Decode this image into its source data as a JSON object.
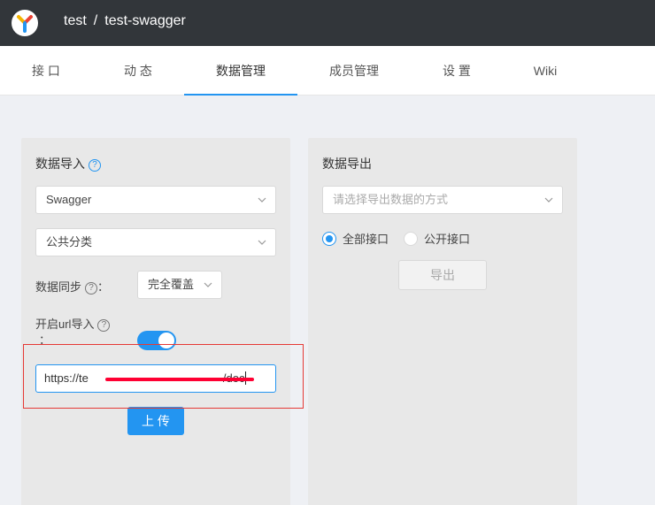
{
  "header": {
    "group": "test",
    "separator": "/",
    "project": "test-swagger"
  },
  "tabs": [
    {
      "label": "接 口"
    },
    {
      "label": "动 态"
    },
    {
      "label": "数据管理",
      "active": true
    },
    {
      "label": "成员管理"
    },
    {
      "label": "设 置"
    },
    {
      "label": "Wiki"
    }
  ],
  "import_panel": {
    "title": "数据导入",
    "help_glyph": "?",
    "format_select": "Swagger",
    "category_select": "公共分类",
    "sync_label": "数据同步",
    "sync_colon": "：",
    "sync_select": "完全覆盖",
    "url_label": "开启url导入",
    "url_colon": "：",
    "url_toggle_on": true,
    "url_value_start": "https://te",
    "url_value_end": "/doc",
    "upload_button": "上 传"
  },
  "export_panel": {
    "title": "数据导出",
    "method_placeholder": "请选择导出数据的方式",
    "radio_all": "全部接口",
    "radio_public": "公开接口",
    "selected_radio": "all",
    "export_button": "导出"
  },
  "colors": {
    "topbar": "#32363a",
    "accent": "#2395f1",
    "annotation": "#e53935"
  }
}
